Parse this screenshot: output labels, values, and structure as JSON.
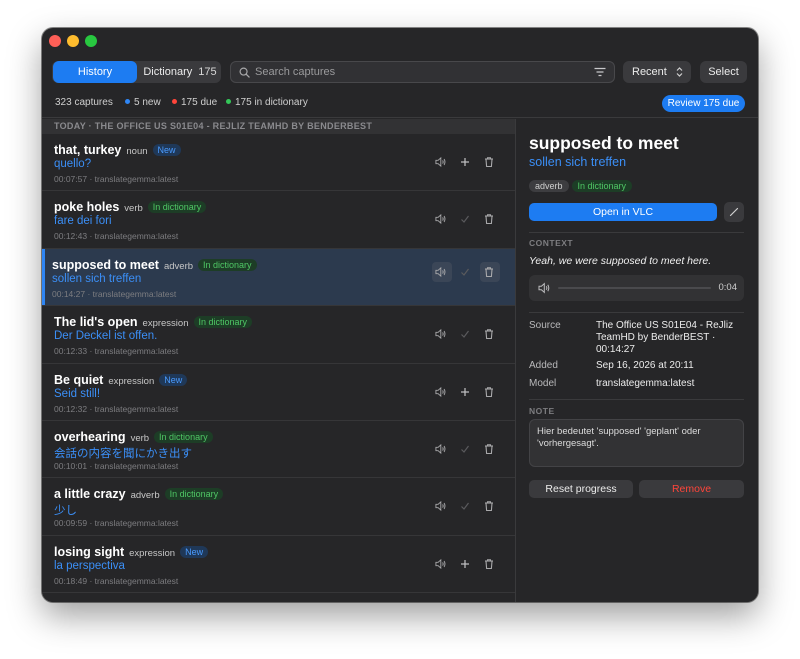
{
  "toolbar": {
    "history_label": "History",
    "dictionary_label": "Dictionary",
    "dictionary_count": "175",
    "search_placeholder": "Search captures",
    "sort_label": "Recent",
    "select_label": "Select"
  },
  "stats": {
    "captures": "323 captures",
    "new": "5 new",
    "due": "175 due",
    "in_dictionary": "175 in dictionary",
    "review_button": "Review 175 due"
  },
  "colors": {
    "accent": "#1d7cf2",
    "new_dot": "#2f86f5",
    "due_dot": "#ff453a",
    "dict_dot": "#34c759",
    "remove": "#ff453a"
  },
  "section_header": "TODAY · THE OFFICE US S01E04 - REJLIZ TEAMHD BY BENDERBEST",
  "captures": [
    {
      "word": "that, turkey",
      "pos": "noun",
      "badge": "New",
      "badge_type": "new",
      "translation": "quello?",
      "meta": "00:07:57 · translategemma:latest",
      "action": "add-icon",
      "selected": false
    },
    {
      "word": "poke holes",
      "pos": "verb",
      "badge": "In dictionary",
      "badge_type": "dict",
      "translation": "fare dei fori",
      "meta": "00:12:43 · translategemma:latest",
      "action": "check-icon",
      "selected": false
    },
    {
      "word": "supposed to meet",
      "pos": "adverb",
      "badge": "In dictionary",
      "badge_type": "dict",
      "translation": "sollen sich treffen",
      "meta": "00:14:27 · translategemma:latest",
      "action": "check-icon",
      "selected": true
    },
    {
      "word": "The lid's open",
      "pos": "expression",
      "badge": "In dictionary",
      "badge_type": "dict",
      "translation": "Der Deckel ist offen.",
      "meta": "00:12:33 · translategemma:latest",
      "action": "check-icon",
      "selected": false
    },
    {
      "word": "Be quiet",
      "pos": "expression",
      "badge": "New",
      "badge_type": "new",
      "translation": "Seid still!",
      "meta": "00:12:32 · translategemma:latest",
      "action": "add-icon",
      "selected": false
    },
    {
      "word": "overhearing",
      "pos": "verb",
      "badge": "In dictionary",
      "badge_type": "dict",
      "translation": "会話の内容を聞にかき出す",
      "meta": "00:10:01 · translategemma:latest",
      "action": "check-icon",
      "selected": false
    },
    {
      "word": "a little crazy",
      "pos": "adverb",
      "badge": "In dictionary",
      "badge_type": "dict",
      "translation": "少し",
      "meta": "00:09:59 · translategemma:latest",
      "action": "check-icon",
      "selected": false
    },
    {
      "word": "losing sight",
      "pos": "expression",
      "badge": "New",
      "badge_type": "new",
      "translation": "la perspectiva",
      "meta": "00:18:49 · translategemma:latest",
      "action": "add-icon",
      "selected": false
    }
  ],
  "detail": {
    "word": "supposed to meet",
    "translation": "sollen sich treffen",
    "pos": "adverb",
    "status": "In dictionary",
    "open_button": "Open in VLC",
    "context_label": "CONTEXT",
    "context": "Yeah, we were supposed to meet here.",
    "audio_time": "0:04",
    "source_label": "Source",
    "source": "The Office US S01E04 - ReJliz TeamHD by BenderBEST · 00:14:27",
    "added_label": "Added",
    "added": "Sep 16, 2026 at 20:11",
    "model_label": "Model",
    "model": "translategemma:latest",
    "note_label": "NOTE",
    "note": "Hier bedeutet 'supposed' 'geplant' oder 'vorhergesagt'.",
    "reset_button": "Reset progress",
    "remove_button": "Remove"
  }
}
